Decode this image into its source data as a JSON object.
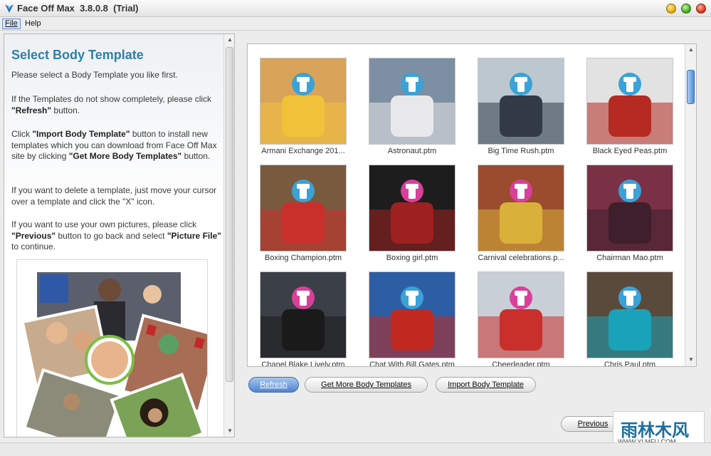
{
  "window": {
    "title": "Face Off Max  3.8.0.8  (Trial)"
  },
  "menu": {
    "file": "File",
    "help": "Help"
  },
  "left_panel": {
    "title": "Select Body Template",
    "intro": "Please select a Body Template you like first.",
    "refresh_help_1": "If the Templates do not show completely, please click ",
    "refresh_help_bold": "\"Refresh\"",
    "refresh_help_2": " button.",
    "import_help_1": "Click ",
    "import_help_bold_1": "\"Import Body Template\"",
    "import_help_2": " button to install new templates which you can download from Face Off Max site by clicking ",
    "import_help_bold_2": "\"Get More Body Templates\"",
    "import_help_3": " button.",
    "delete_help": "If you want to delete a template, just move your cursor over a template and click the \"X\" icon.",
    "own_help_1": "If you want to use your own pictures, please click ",
    "own_help_bold_1": "\"Previous\"",
    "own_help_2": " button to go back and select ",
    "own_help_bold_2": "\"Picture File\"",
    "own_help_3": " to continue."
  },
  "templates": [
    {
      "name": "Armani Exchange 201...",
      "bg": "#d9a35a",
      "accent": "#f0c23a",
      "face": "blue"
    },
    {
      "name": "Astronaut.ptm",
      "bg": "#7d8fa3",
      "accent": "#e8e8ea",
      "face": "blue"
    },
    {
      "name": "Big Time Rush.ptm",
      "bg": "#bcc7cf",
      "accent": "#323a48",
      "face": "blue"
    },
    {
      "name": "Black Eyed Peas.ptm",
      "bg": "#e2e2e2",
      "accent": "#b52a22",
      "face": "blue"
    },
    {
      "name": "Boxing Champion.ptm",
      "bg": "#7a5a3d",
      "accent": "#c9302c",
      "face": "blue"
    },
    {
      "name": "Boxing girl.ptm",
      "bg": "#1d1d1d",
      "accent": "#9e2020",
      "face": "pink"
    },
    {
      "name": "Carnival celebrations.p...",
      "bg": "#9b4c2e",
      "accent": "#d9b13a",
      "face": "pink"
    },
    {
      "name": "Chairman Mao.ptm",
      "bg": "#7b3145",
      "accent": "#3e1f2b",
      "face": "blue"
    },
    {
      "name": "Chanel Blake Lively.ptm",
      "bg": "#3b3f47",
      "accent": "#1a1a1a",
      "face": "pink"
    },
    {
      "name": "Chat With Bill Gates.ptm",
      "bg": "#2d5ea3",
      "accent": "#c02a20",
      "face": "blue"
    },
    {
      "name": "Cheerleader.ptm",
      "bg": "#c9cfd6",
      "accent": "#c9302c",
      "face": "pink"
    },
    {
      "name": "Chris Paul.ptm",
      "bg": "#5a4a3c",
      "accent": "#1aa3b8",
      "face": "blue"
    }
  ],
  "buttons": {
    "refresh": "Refresh",
    "get_more": "Get More Body Templates",
    "import": "Import Body Template",
    "previous": "Previous"
  },
  "watermark": {
    "text": "雨林木风",
    "url": "WWW.YLMFU.COM"
  },
  "colors": {
    "title_accent": "#2e7fa6",
    "primary_button": "#4f84cf",
    "face_blue": "#3aa2d6",
    "face_pink": "#d8409a"
  }
}
